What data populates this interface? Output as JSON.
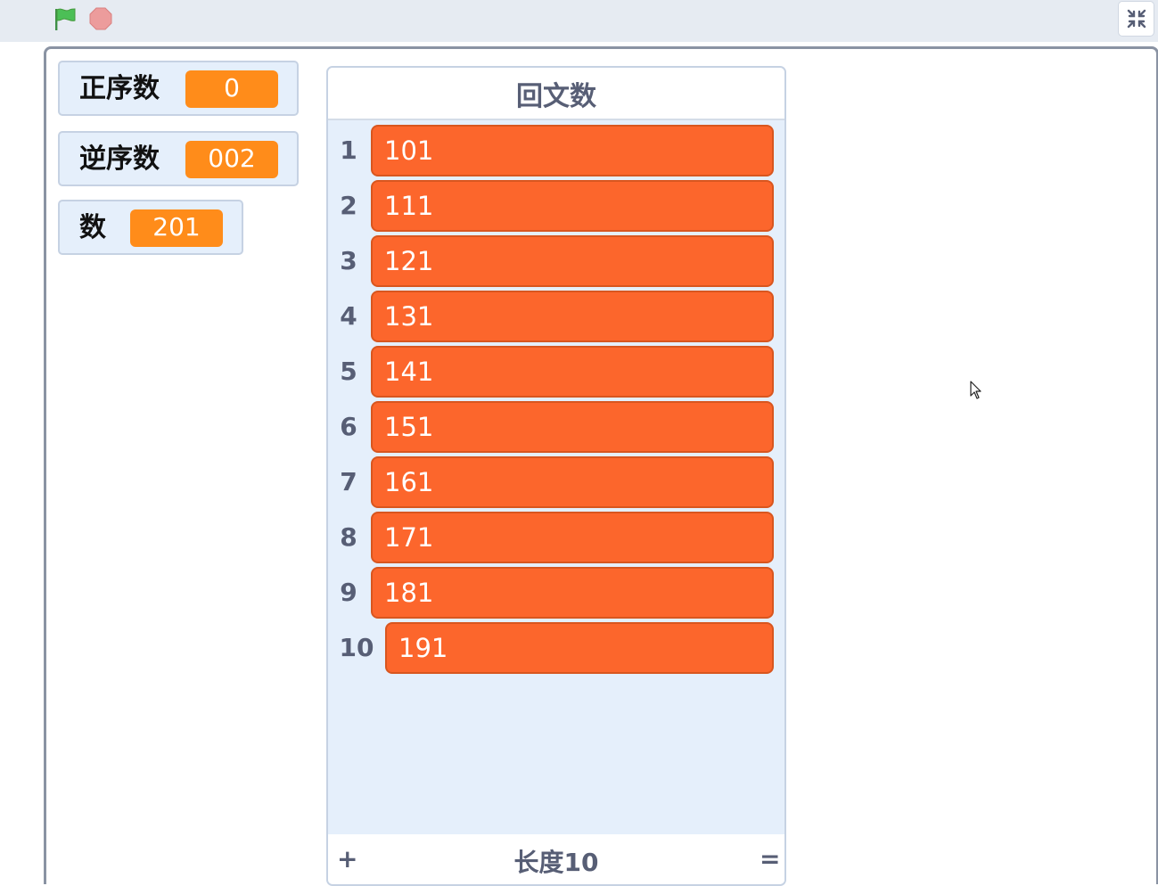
{
  "toolbar": {
    "green_flag_color": "#4cbf56",
    "stop_color": "#ec9c9c",
    "exit_fullscreen_icon": "unfullscreen-icon"
  },
  "monitors": [
    {
      "label": "正序数",
      "value": "0"
    },
    {
      "label": "逆序数",
      "value": "002"
    },
    {
      "label": "数",
      "value": "201"
    }
  ],
  "list": {
    "title": "回文数",
    "items": [
      {
        "index": "1",
        "value": "101"
      },
      {
        "index": "2",
        "value": "111"
      },
      {
        "index": "3",
        "value": "121"
      },
      {
        "index": "4",
        "value": "131"
      },
      {
        "index": "5",
        "value": "141"
      },
      {
        "index": "6",
        "value": "151"
      },
      {
        "index": "7",
        "value": "161"
      },
      {
        "index": "8",
        "value": "171"
      },
      {
        "index": "9",
        "value": "181"
      },
      {
        "index": "10",
        "value": "191"
      }
    ],
    "add_label": "+",
    "length_label": "长度10",
    "resize_label": "="
  },
  "colors": {
    "variable_orange": "#ff8c1a",
    "list_item_orange": "#fc662c",
    "monitor_bg": "#e5effb",
    "text_gray": "#575e75"
  }
}
